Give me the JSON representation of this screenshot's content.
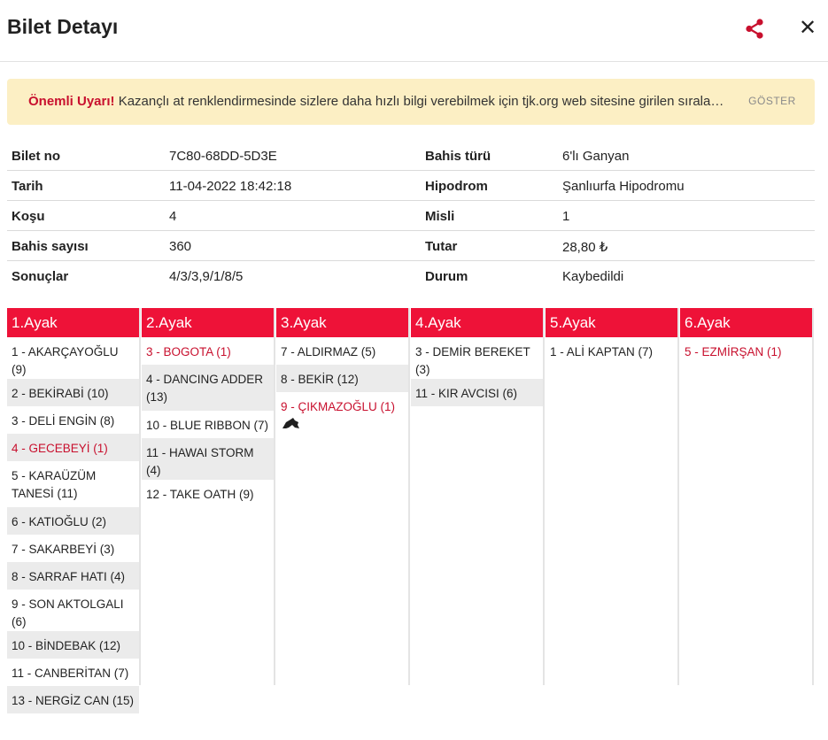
{
  "header": {
    "title": "Bilet Detayı",
    "share_icon": "share-icon",
    "close_label": "✕"
  },
  "alert": {
    "strong": "Önemli Uyarı!",
    "text": " Kazançlı at renklendirmesinde sizlere daha hızlı bilgi verebilmek için tjk.org web sitesine girilen sırala…",
    "button": "GÖSTER"
  },
  "info": {
    "rows": [
      {
        "label1": "Bilet no",
        "value1": "7C80-68DD-5D3E",
        "label2": "Bahis türü",
        "value2": "6'lı Ganyan"
      },
      {
        "label1": "Tarih",
        "value1": "11-04-2022 18:42:18",
        "label2": "Hipodrom",
        "value2": "Şanlıurfa Hipodromu"
      },
      {
        "label1": "Koşu",
        "value1": "4",
        "label2": "Misli",
        "value2": "1"
      },
      {
        "label1": "Bahis sayısı",
        "value1": "360",
        "label2": "Tutar",
        "value2": "28,80 ₺"
      },
      {
        "label1": "Sonuçlar",
        "value1": "4/3/3,9/1/8/5",
        "label2": "Durum",
        "value2": "Kaybedildi"
      }
    ]
  },
  "colors": {
    "accent": "#ee1238",
    "winner": "#c8102e",
    "alert_bg": "#fcefc4",
    "alt_row": "#ebebeb"
  },
  "legs": [
    {
      "title": "1.Ayak",
      "horses": [
        "1 - AKARÇAYOĞLU (9)",
        "2 - BEKİRABİ (10)",
        "3 - DELİ ENGİN (8)",
        "4 - GECEBEYİ (1)",
        "5 - KARAÜZÜM TANESİ (11)",
        "6 - KATIOĞLU (2)",
        "7 - SAKARBEYİ (3)",
        "8 - SARRAF HATI (4)",
        "9 - SON AKTOLGALI (6)",
        "10 - BİNDEBAK (12)",
        "11 - CANBERİTAN (7)",
        "13 - NERGİZ CAN (15)"
      ]
    },
    {
      "title": "2.Ayak",
      "horses": [
        "3 - BOGOTA (1)",
        "4 - DANCING ADDER (13)",
        "10 - BLUE RIBBON (7)",
        "11 - HAWAI STORM (4)",
        "12 - TAKE OATH (9)"
      ]
    },
    {
      "title": "3.Ayak",
      "horses": [
        "7 - ALDIRMAZ (5)",
        "8 - BEKİR (12)",
        "9 - ÇIKMAZOĞLU (1)"
      ]
    },
    {
      "title": "4.Ayak",
      "horses": [
        "3 - DEMİR BEREKET (3)",
        "11 - KIR AVCISI (6)"
      ]
    },
    {
      "title": "5.Ayak",
      "horses": [
        "1 - ALİ KAPTAN (7)"
      ]
    },
    {
      "title": "6.Ayak",
      "horses": [
        "5 - EZMİRŞAN (1)"
      ]
    }
  ]
}
